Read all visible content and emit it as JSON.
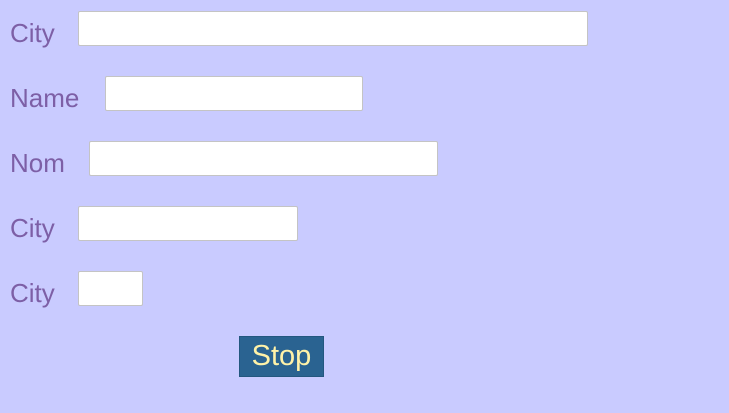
{
  "form": {
    "rows": [
      {
        "label": "City",
        "value": ""
      },
      {
        "label": "Name",
        "value": ""
      },
      {
        "label": "Nom",
        "value": ""
      },
      {
        "label": "City",
        "value": ""
      },
      {
        "label": "City",
        "value": ""
      }
    ],
    "submit_label": "Stop"
  },
  "colors": {
    "background": "#c9cbff",
    "label_text": "#7d5fa6",
    "button_background": "#2a6391",
    "button_text": "#fff2a8"
  }
}
